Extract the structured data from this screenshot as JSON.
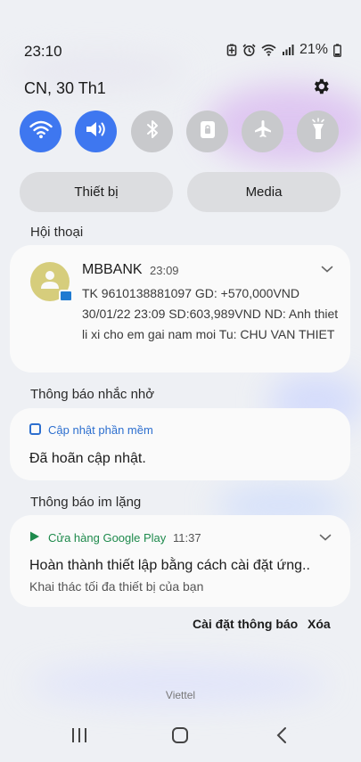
{
  "status_bar": {
    "time": "23:10",
    "battery": "21%",
    "icons": [
      "battery-saver-icon",
      "alarm-icon",
      "wifi-icon",
      "signal-icon",
      "battery-icon"
    ]
  },
  "header": {
    "date": "CN, 30 Th1",
    "settings_icon": "gear-icon"
  },
  "quick_toggles": [
    {
      "name": "wifi",
      "icon": "wifi-icon",
      "on": true
    },
    {
      "name": "sound",
      "icon": "volume-icon",
      "on": true
    },
    {
      "name": "bluetooth",
      "icon": "bluetooth-icon",
      "on": false
    },
    {
      "name": "rotation-lock",
      "icon": "lock-icon",
      "on": false
    },
    {
      "name": "airplane",
      "icon": "airplane-icon",
      "on": false
    },
    {
      "name": "flashlight",
      "icon": "flashlight-icon",
      "on": false
    }
  ],
  "output": {
    "device_label": "Thiết bị",
    "media_label": "Media"
  },
  "sections": {
    "conversations": "Hội thoại",
    "reminders": "Thông báo nhắc nhở",
    "silent": "Thông báo im lặng"
  },
  "notifications": {
    "mbbank": {
      "sender": "MBBANK",
      "time": "23:09",
      "body": "TK 9610138881097 GD: +570,000VND 30/01/22 23:09 SD:603,989VND ND: Anh thiet li xi cho em gai nam moi Tu: CHU VAN THIET"
    },
    "update": {
      "app": "Cập nhật phần mềm",
      "title": "Đã hoãn cập nhật."
    },
    "play": {
      "app": "Cửa hàng Google Play",
      "time": "11:37",
      "title": "Hoàn thành thiết lập bằng cách cài đặt ứng..",
      "subtitle": "Khai thác tối đa thiết bị của bạn"
    }
  },
  "actions": {
    "settings": "Cài đặt thông báo",
    "clear": "Xóa"
  },
  "carrier": "Viettel",
  "colors": {
    "accent": "#3e77f0",
    "toggle_off": "#c8c9cc",
    "update_blue": "#2d6fcf",
    "play_green": "#1e8a4c",
    "avatar": "#d6cd7c"
  }
}
